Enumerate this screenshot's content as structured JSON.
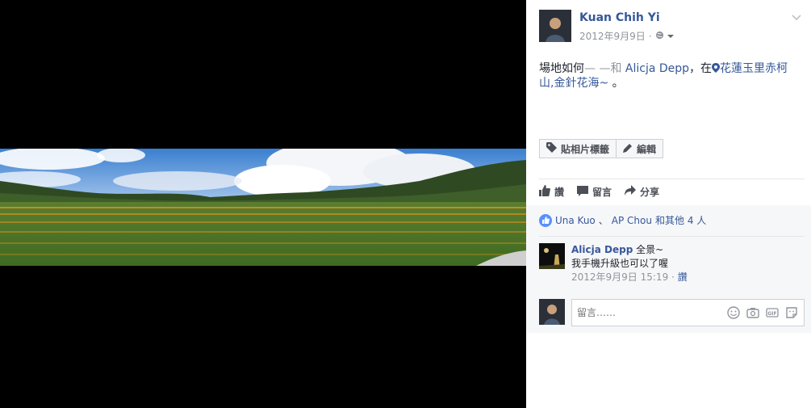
{
  "post": {
    "author": "Kuan Chih Yi",
    "date": "2012年9月9日",
    "meta_sep": "·",
    "text_prefix": "場地如何",
    "text_dash": "— —和 ",
    "tagged": "Alicja Depp",
    "text_at": "，在",
    "location": "花蓮玉里赤柯山,金針花海~",
    "text_suffix": " 。"
  },
  "photo_actions": {
    "tag": "貼相片標籤",
    "edit": "編輯"
  },
  "actions": {
    "like": "讚",
    "comment": "留言",
    "share": "分享"
  },
  "likes": {
    "name1": "Una Kuo",
    "sep": "、",
    "name2": "AP Chou",
    "others": "和其他 4 人"
  },
  "comment": {
    "author": "Alicja Depp",
    "line1": "全景~",
    "line2": "我手機升級也可以了喔",
    "timestamp": "2012年9月9日 15:19",
    "meta_sep": "·",
    "like": "讚"
  },
  "reply": {
    "placeholder": "留言……"
  },
  "colors": {
    "link": "#365899",
    "muted": "#90949c",
    "like_badge": "#5890ff"
  },
  "icons": [
    "chevron-down-icon",
    "globe-icon",
    "location-pin-icon",
    "tag-icon",
    "pencil-icon",
    "thumbs-up-icon",
    "comment-icon",
    "share-icon",
    "emoji-icon",
    "camera-icon",
    "gif-icon",
    "sticker-icon"
  ]
}
